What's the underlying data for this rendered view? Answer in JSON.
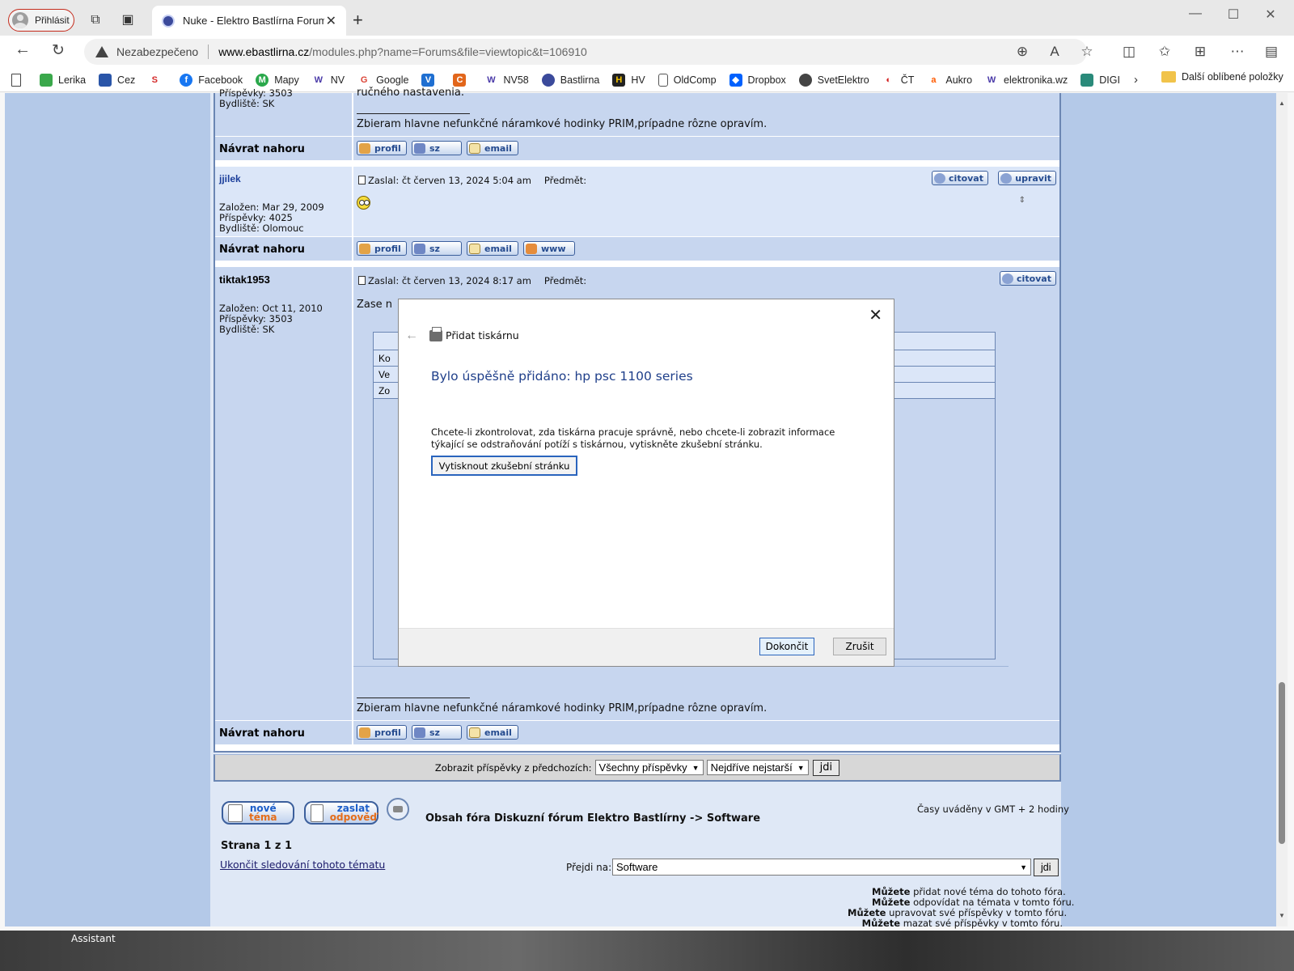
{
  "browser": {
    "profile_label": "Přihlásit",
    "tab_title": "Nuke - Elektro Bastlírna Forums-",
    "security_label": "Nezabezpečeno",
    "url_host": "www.ebastlirna.cz",
    "url_path": "/modules.php?name=Forums&file=viewtopic&t=106910"
  },
  "favorites": [
    {
      "label": "Lerika",
      "icon": "lerika-icon",
      "color": "#3aa84b"
    },
    {
      "label": "Cez",
      "icon": "cez-icon",
      "color": "#2a55a8"
    },
    {
      "label": "",
      "icon": "s-logo-icon",
      "color": "#d42a2a"
    },
    {
      "label": "Facebook",
      "icon": "facebook-icon",
      "color": "#1877f2"
    },
    {
      "label": "Mapy",
      "icon": "mapy-icon",
      "color": "#2aa84b"
    },
    {
      "label": "NV",
      "icon": "w-icon",
      "color": "#4a3aa8"
    },
    {
      "label": "Google",
      "icon": "google-icon",
      "color": "#db4437"
    },
    {
      "label": "",
      "icon": "v-logo-icon",
      "color": "#1f6fd1"
    },
    {
      "label": "",
      "icon": "c-logo-icon",
      "color": "#e2661b"
    },
    {
      "label": "NV58",
      "icon": "w-icon",
      "color": "#4a3aa8"
    },
    {
      "label": "Bastlirna",
      "icon": "bastlirna-icon",
      "color": "#3b4a9b"
    },
    {
      "label": "HV",
      "icon": "hv-icon",
      "color": "#222222"
    },
    {
      "label": "OldComp",
      "icon": "page-icon",
      "color": "#888888"
    },
    {
      "label": "Dropbox",
      "icon": "dropbox-icon",
      "color": "#0061fe"
    },
    {
      "label": "SvetElektro",
      "icon": "svetelektro-icon",
      "color": "#444444"
    },
    {
      "label": "ČT",
      "icon": "ct-icon",
      "color": "#d32020"
    },
    {
      "label": "Aukro",
      "icon": "aukro-icon",
      "color": "#ff5a00"
    },
    {
      "label": "elektronika.wz",
      "icon": "w-icon",
      "color": "#4a3aa8"
    },
    {
      "label": "DIGI",
      "icon": "digi-icon",
      "color": "#2a8a7a"
    }
  ],
  "favorites_other": "Další oblíbené položky",
  "forum": {
    "post0": {
      "prispevky": "Příspěvky: 3503",
      "bydliste": "Bydliště: SK",
      "body_tail": "ručného nastavenia.",
      "signature": "Zbieram hlavne nefunkčné náramkové hodinky PRIM,prípadne rôzne opravím."
    },
    "nav_label": "Návrat nahoru",
    "buttons": {
      "profil": "profil",
      "sz": "sz",
      "email": "email",
      "www": "www",
      "citovat": "citovat",
      "upravit": "upravit"
    },
    "post1": {
      "username": "jjilek",
      "zalozen": "Založen: Mar 29, 2009",
      "prispevky": "Příspěvky: 4025",
      "bydliste": "Bydliště: Olomouc",
      "zaslal": "Zaslal: čt červen 13, 2024 5:04 am",
      "predmet": "Předmět:"
    },
    "post2": {
      "username": "tiktak1953",
      "zalozen": "Založen: Oct 11, 2010",
      "prispevky": "Příspěvky: 3503",
      "bydliste": "Bydliště: SK",
      "zaslal": "Zaslal: čt červen 13, 2024 8:17 am",
      "predmet": "Předmět:",
      "body_start": "Zase n",
      "table_rows": [
        "Ko",
        "Ve",
        "Zo"
      ],
      "signature": "Zbieram hlavne nefunkčné náramkové hodinky PRIM,prípadne rôzne opravím."
    },
    "filter": {
      "label": "Zobrazit příspěvky z předchozích:",
      "period": "Všechny příspěvky",
      "order": "Nejdříve nejstarší",
      "go": "jdi"
    },
    "timezone": "Časy uváděny v GMT + 2 hodiny",
    "new_topic": {
      "line1": "nové",
      "line2": "téma"
    },
    "reply": {
      "line1": "zaslat",
      "line2": "odpověď"
    },
    "breadcrumb": "Obsah fóra Diskuzní fórum Elektro Bastlírny -> Software",
    "page_info": "Strana 1 z 1",
    "unwatch": "Ukončit sledování tohoto tématu",
    "jump_label": "Přejdi na:",
    "jump_value": "Software",
    "jump_go": "jdi",
    "permissions": [
      {
        "b": "Můžete",
        "t": " přidat nové téma do tohoto fóra."
      },
      {
        "b": "Můžete",
        "t": " odpovídat na témata v tomto fóru."
      },
      {
        "b": "Můžete",
        "t": " upravovat své příspěvky v tomto fóru."
      },
      {
        "b": "Můžete",
        "t": " mazat své příspěvky v tomto fóru."
      }
    ]
  },
  "dialog": {
    "title": "Přidat tiskárnu",
    "heading": "Bylo úspěšně přidáno: hp psc 1100 series",
    "description": "Chcete-li zkontrolovat, zda tiskárna pracuje správně, nebo chcete-li zobrazit informace týkající se odstraňování potíží s tiskárnou, vytiskněte zkušební stránku.",
    "test_button": "Vytisknout zkušební stránku",
    "finish_button": "Dokončit",
    "cancel_button": "Zrušit"
  },
  "taskbar": {
    "assistant": "Assistant"
  }
}
